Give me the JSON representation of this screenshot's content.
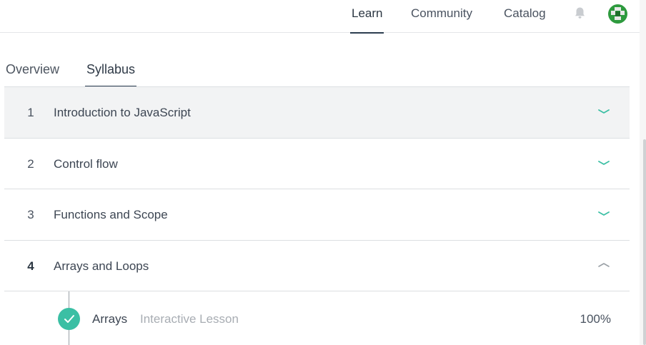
{
  "nav": {
    "items": [
      {
        "label": "Learn",
        "active": true
      },
      {
        "label": "Community",
        "active": false
      },
      {
        "label": "Catalog",
        "active": false
      }
    ],
    "icons": [
      "bell-icon",
      "avatar"
    ]
  },
  "tabs": [
    {
      "label": "Overview",
      "active": false
    },
    {
      "label": "Syllabus",
      "active": true
    }
  ],
  "syllabus": {
    "sections": [
      {
        "number": "1",
        "title": "Introduction to JavaScript",
        "expanded": false
      },
      {
        "number": "2",
        "title": "Control flow",
        "expanded": false
      },
      {
        "number": "3",
        "title": "Functions and Scope",
        "expanded": false
      },
      {
        "number": "4",
        "title": "Arrays and Loops",
        "expanded": true
      }
    ],
    "lessons": [
      {
        "title": "Arrays",
        "type": "Interactive Lesson",
        "progress": "100%",
        "completed": true
      }
    ]
  },
  "colors": {
    "accent": "#3bbfa4",
    "underline": "#2c3e50",
    "highlight_row": "#f2f3f4"
  }
}
